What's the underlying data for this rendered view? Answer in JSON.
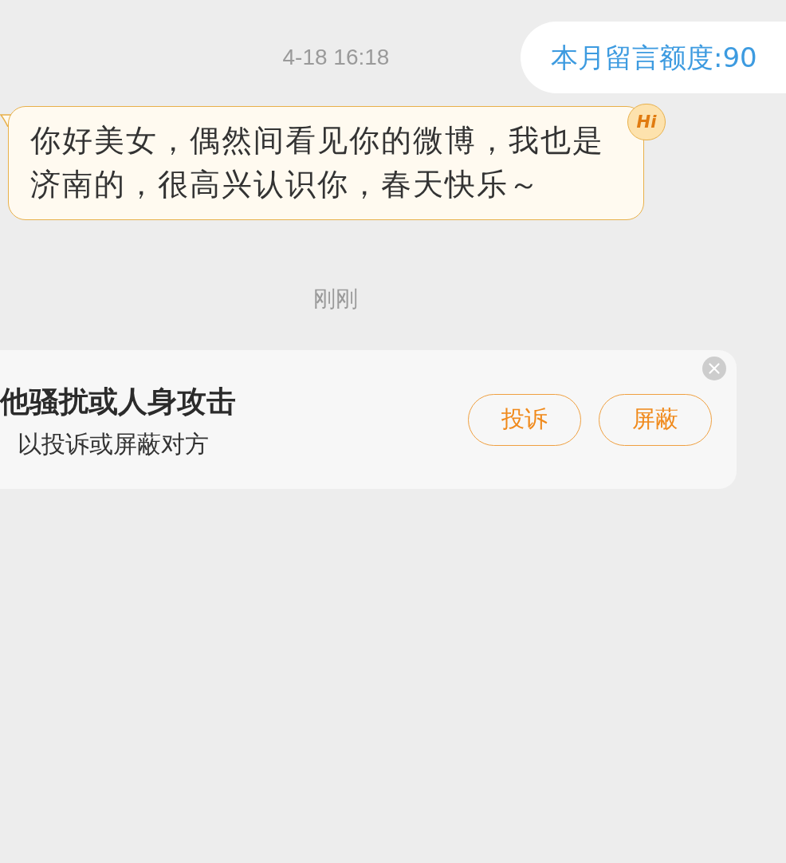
{
  "header": {
    "timestamp": "4-18 16:18",
    "quota": "本月留言额度:90"
  },
  "message": {
    "text": "你好美女，偶然间看见你的微博，我也是济南的，很高兴认识你，春天快乐～",
    "badge": "Hi"
  },
  "divider_time": "刚刚",
  "notice": {
    "title": "他骚扰或人身攻击",
    "subtitle": "以投诉或屏蔽对方",
    "buttons": [
      "投诉",
      "屏蔽"
    ]
  }
}
